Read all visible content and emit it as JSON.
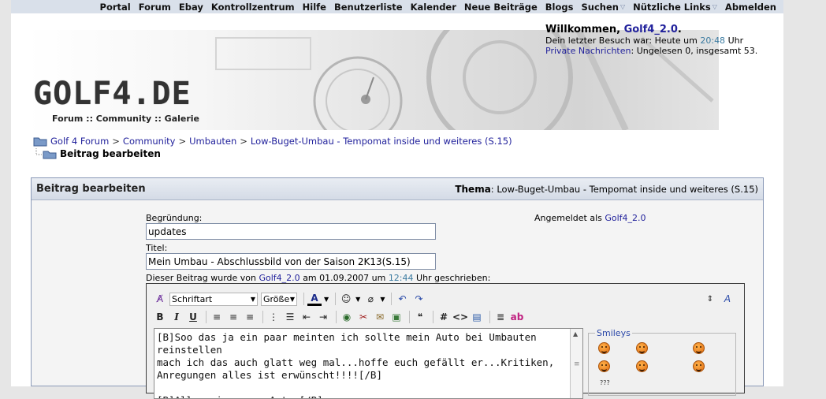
{
  "topnav": {
    "items": [
      "Portal",
      "Forum",
      "Ebay",
      "Kontrollzentrum",
      "Hilfe",
      "Benutzerliste",
      "Kalender",
      "Neue Beiträge",
      "Blogs",
      "Suchen",
      "Nützliche Links",
      "Abmelden"
    ]
  },
  "header": {
    "logo_text": "GOLF4.DE",
    "logo_sub": "Forum :: Community :: Galerie"
  },
  "welcome": {
    "title": "Willkommen,",
    "username": "Golf4_2.0",
    "period": ".",
    "last_visit_prefix": "Dein letzter Besuch war: Heute um",
    "last_visit_time": "20:48",
    "last_visit_suffix": "Uhr",
    "pm_label": "Private Nachrichten",
    "pm_text": ": Ungelesen 0, insgesamt 53."
  },
  "breadcrumb": {
    "items": [
      "Golf 4 Forum",
      "Community",
      "Umbauten",
      "Low-Buget-Umbau - Tempomat inside und weiteres (S.15)"
    ],
    "separator": ">",
    "current": "Beitrag bearbeiten"
  },
  "panel": {
    "title": "Beitrag bearbeiten",
    "topic_label": "Thema",
    "topic_value": ": Low-Buget-Umbau - Tempomat inside und weiteres (S.15)",
    "reason_label": "Begründung:",
    "reason_value": "updates",
    "title_label": "Titel:",
    "title_value": "Mein Umbau - Abschlussbild von der Saison 2K13(S.15)",
    "logged_in_label": "Angemeldet als",
    "logged_in_user": "Golf4_2.0",
    "written_prefix": "Dieser Beitrag wurde von",
    "written_user": "Golf4_2.0",
    "written_am": "am 01.09.2007 um",
    "written_time": "12:44",
    "written_suffix": "Uhr geschrieben:"
  },
  "editor": {
    "font_select": "Schriftart",
    "size_select": "Größe",
    "message": "[B]Soo das ja ein paar meinten ich sollte mein Auto bei Umbauten reinstellen\nmach ich das auch glatt weg mal...hoffe euch gefällt er...Kritiken,\nAnregungen alles ist erwünscht!!!![/B]\n\n[B]Allgemeines zum Auto:[/B]",
    "smileys_legend": "Smileys",
    "smiley_extra": "???"
  },
  "colors": {
    "link": "#22229c",
    "nav_bg": "#d9e0ea",
    "panel_border": "#8b9ab8",
    "smiley_legend": "#2b48a8",
    "time_color": "#3a7aa0"
  }
}
